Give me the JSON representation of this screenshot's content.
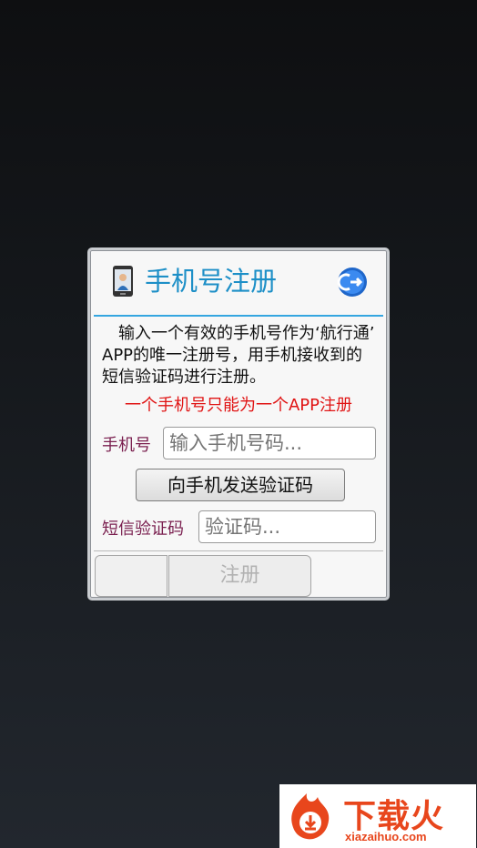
{
  "dialog": {
    "title": "手机号注册",
    "description": "输入一个有效的手机号作为‘航行通’ APP的唯一注册号，用手机接收到的短信验证码进行注册。",
    "warning": "一个手机号只能为一个APP注册",
    "phone_label": "手机号",
    "phone_placeholder": "输入手机号码...",
    "send_code_label": "向手机发送验证码",
    "sms_label": "短信验证码",
    "sms_placeholder": "验证码...",
    "register_label": "注册"
  },
  "watermark": {
    "brand": "下载火",
    "domain": "xiazaihuo.com"
  },
  "colors": {
    "title": "#1d8fc7",
    "warning": "#e01414",
    "label": "#7a1f4f",
    "accent": "#35a6e0"
  },
  "icons": {
    "header_left": "phone-icon",
    "header_right": "exit-icon"
  }
}
